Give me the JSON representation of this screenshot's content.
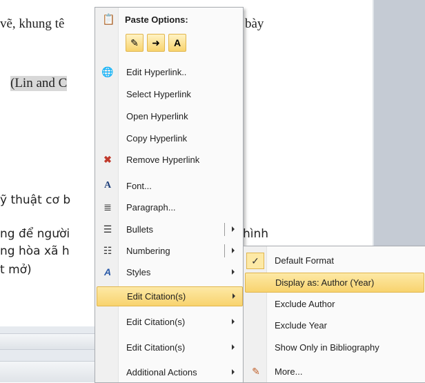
{
  "document": {
    "line1": "vẽ, khung tê",
    "line1_right": "bày",
    "line2": "(Lin and C",
    "line3": "ỹ thuật cơ b",
    "line4a": "ng để người",
    "line4_right": "hình",
    "line5": "ng hòa xã h",
    "line6": "t mở)"
  },
  "menu": {
    "paste_header": "Paste Options:",
    "items": [
      {
        "label": "Edit Hyperlink..",
        "icon": "globe-link-icon"
      },
      {
        "label": "Select Hyperlink"
      },
      {
        "label": "Open Hyperlink"
      },
      {
        "label": "Copy Hyperlink"
      },
      {
        "label": "Remove Hyperlink",
        "icon": "remove-link-icon"
      },
      {
        "label": "Font...",
        "icon": "font-icon"
      },
      {
        "label": "Paragraph...",
        "icon": "paragraph-icon"
      },
      {
        "label": "Bullets",
        "icon": "bullets-icon"
      },
      {
        "label": "Numbering",
        "icon": "numbering-icon"
      },
      {
        "label": "Styles",
        "icon": "styles-icon"
      },
      {
        "label": "Edit Citation(s)"
      },
      {
        "label": "Edit Citation(s)"
      },
      {
        "label": "Edit Citation(s)"
      },
      {
        "label": "Additional Actions"
      }
    ]
  },
  "submenu": {
    "items": [
      {
        "label": "Default Format",
        "checked": true
      },
      {
        "label": "Display as: Author (Year)"
      },
      {
        "label": "Exclude Author"
      },
      {
        "label": "Exclude Year"
      },
      {
        "label": "Show Only in Bibliography"
      },
      {
        "label": "More...",
        "icon": "pencil-icon"
      }
    ]
  },
  "colors": {
    "highlight": "#f8d36e",
    "highlight_border": "#e0b54c"
  }
}
